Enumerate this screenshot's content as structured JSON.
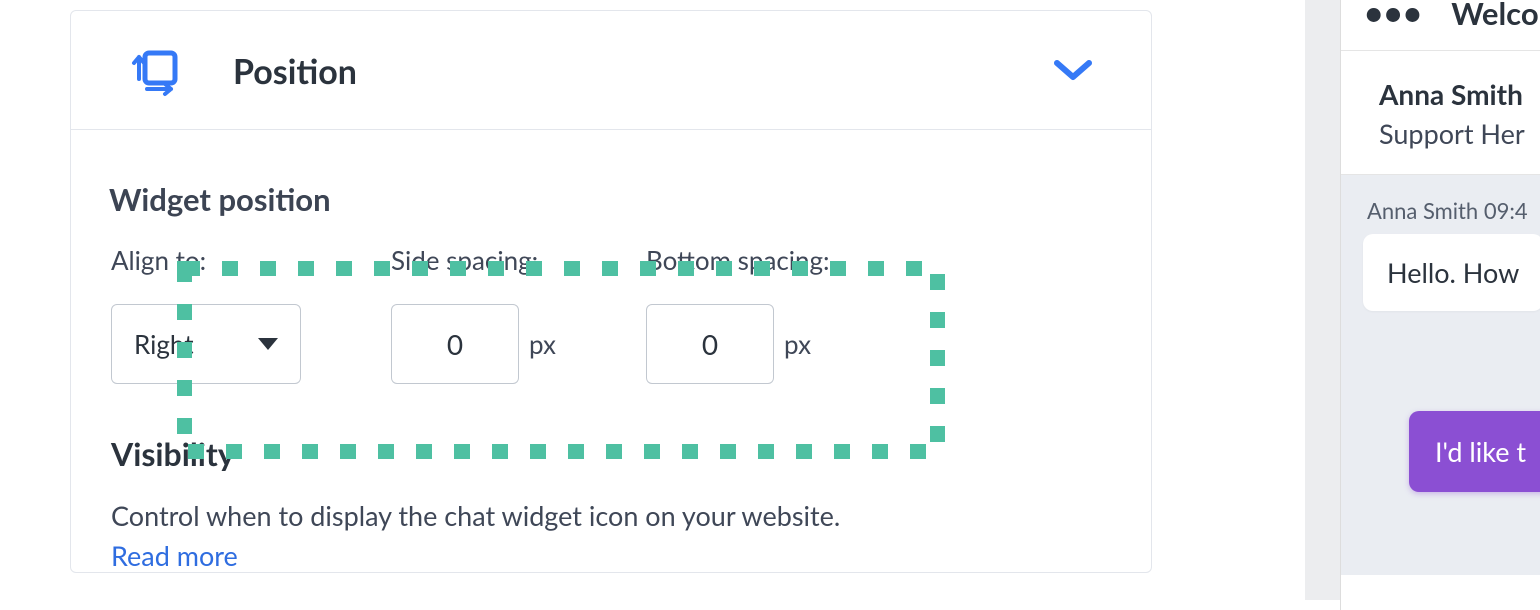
{
  "panel": {
    "title": "Position",
    "widget_position_label": "Widget position",
    "align_label": "Align to:",
    "align_value": "Right",
    "side_label": "Side spacing:",
    "side_value": "0",
    "bottom_label": "Bottom spacing:",
    "bottom_value": "0",
    "unit": "px",
    "visibility_title": "Visibility",
    "visibility_desc": "Control when to display the chat widget icon on your website.",
    "read_more": "Read more"
  },
  "chat": {
    "header": "Welco",
    "agent_name": "Anna Smith",
    "agent_role": "Support Her",
    "msg_meta": "Anna Smith 09:4",
    "msg_in": "Hello. How",
    "msg_out": "I'd like t"
  }
}
